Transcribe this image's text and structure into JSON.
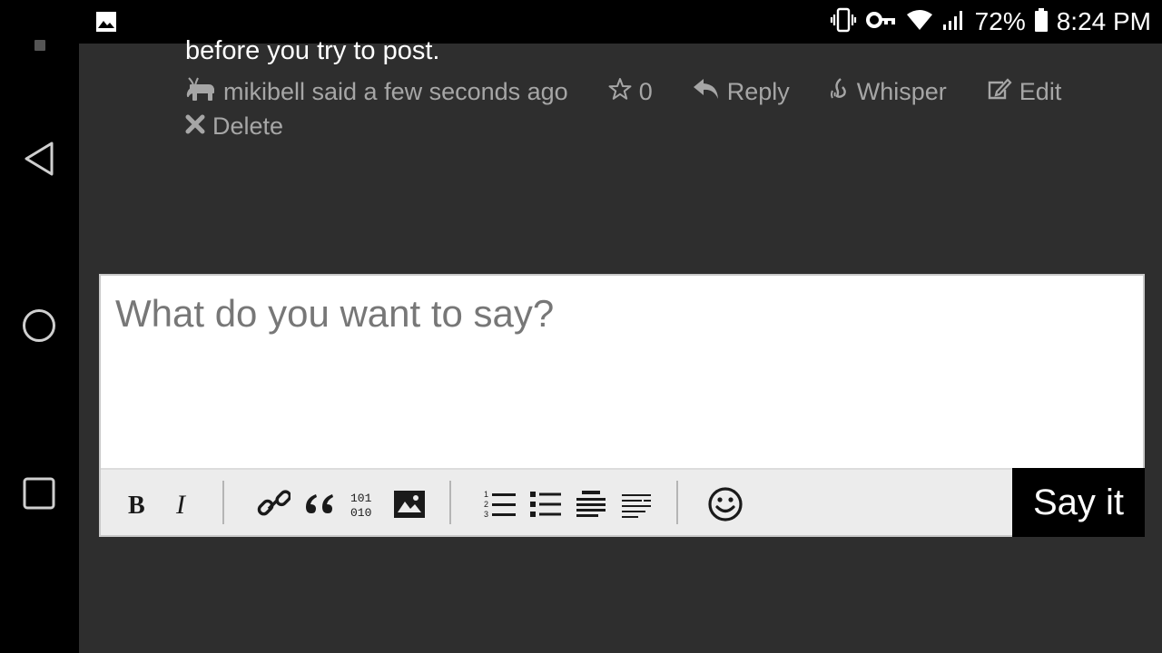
{
  "status_bar": {
    "battery": "72%",
    "time": "8:24 PM",
    "icons": [
      "gallery-icon",
      "vibrate-icon",
      "vpn-key-icon",
      "wifi-icon",
      "signal-icon",
      "battery-icon"
    ]
  },
  "navbar": {
    "icons": [
      "back-icon",
      "home-icon",
      "recents-icon"
    ]
  },
  "post": {
    "tail_text": "before you try to post.",
    "author_said": "mikibell said a few seconds ago",
    "star_count": "0",
    "reply_label": "Reply",
    "whisper_label": "Whisper",
    "edit_label": "Edit",
    "delete_label": "Delete"
  },
  "composer": {
    "placeholder": "What do you want to say?",
    "value": "",
    "submit_label": "Say it",
    "toolbar": [
      "bold-icon",
      "italic-icon",
      "link-icon",
      "quote-icon",
      "code-icon",
      "image-icon",
      "ordered-list-icon",
      "unordered-list-icon",
      "heading-icon",
      "align-icon",
      "emoji-icon"
    ]
  },
  "colors": {
    "background": "#2e2e2e",
    "meta_text": "#a6a6a6",
    "toolbar_bg": "#ececec",
    "submit_bg": "#000000"
  }
}
